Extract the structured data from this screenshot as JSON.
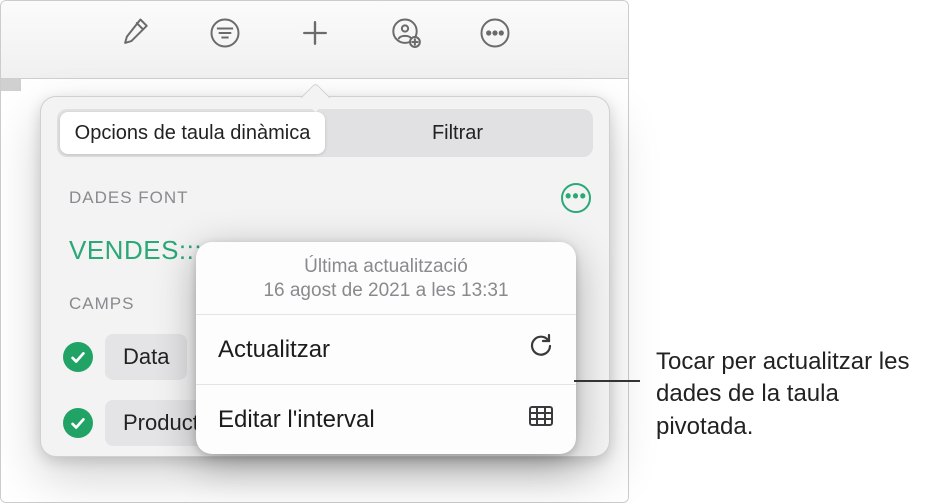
{
  "tabs": {
    "pivot_options": "Opcions de taula dinàmica",
    "filter": "Filtrar"
  },
  "sections": {
    "source_data": "DADES FONT",
    "fields": "CAMPS"
  },
  "source_table": "VENDES:::",
  "fields": [
    {
      "label": "Data"
    },
    {
      "label": "Producte"
    }
  ],
  "update_popover": {
    "last_update_label": "Última actualització",
    "last_update_time": "16 agost de 2021 a les 13:31",
    "refresh": "Actualitzar",
    "edit_range": "Editar l'interval"
  },
  "callout": "Tocar per actualitzar les dades de la taula pivotada."
}
